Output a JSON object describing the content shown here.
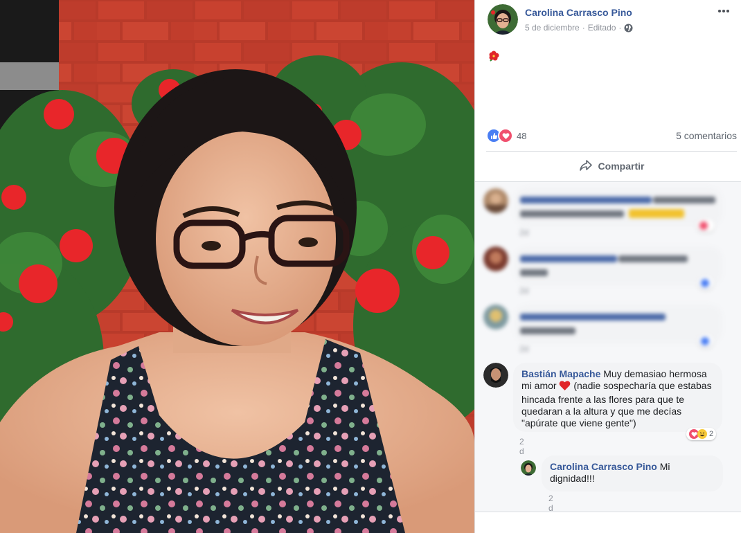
{
  "post": {
    "author": "Carolina Carrasco Pino",
    "date": "5 de diciembre",
    "edited": "Editado",
    "separator": "·",
    "emoji_icon": "hibiscus-flower",
    "reaction_count": "48",
    "comments_link": "5 comentarios",
    "share_label": "Compartir"
  },
  "comments": [
    {
      "blurred": true,
      "time_blurred": "2d"
    },
    {
      "blurred": true,
      "time_blurred": "2d"
    },
    {
      "blurred": true,
      "time_blurred": "2d"
    },
    {
      "name": "Bastián Mapache",
      "text_1": " Muy demasiao hermosa mi amor ",
      "text_2": " (nadie sospecharía que estabas hincada frente a las flores para que te quedaran a la altura y que me decías \"apúrate que viene gente\")",
      "time": "2 d",
      "reaction_count": "2"
    }
  ],
  "reply": {
    "name": "Carolina Carrasco Pino",
    "text": " Mi dignidad!!!",
    "time": "2 d"
  },
  "colors": {
    "link": "#365899",
    "like": "#4a7ef3",
    "love": "#f0506e",
    "meta": "#90949c"
  }
}
